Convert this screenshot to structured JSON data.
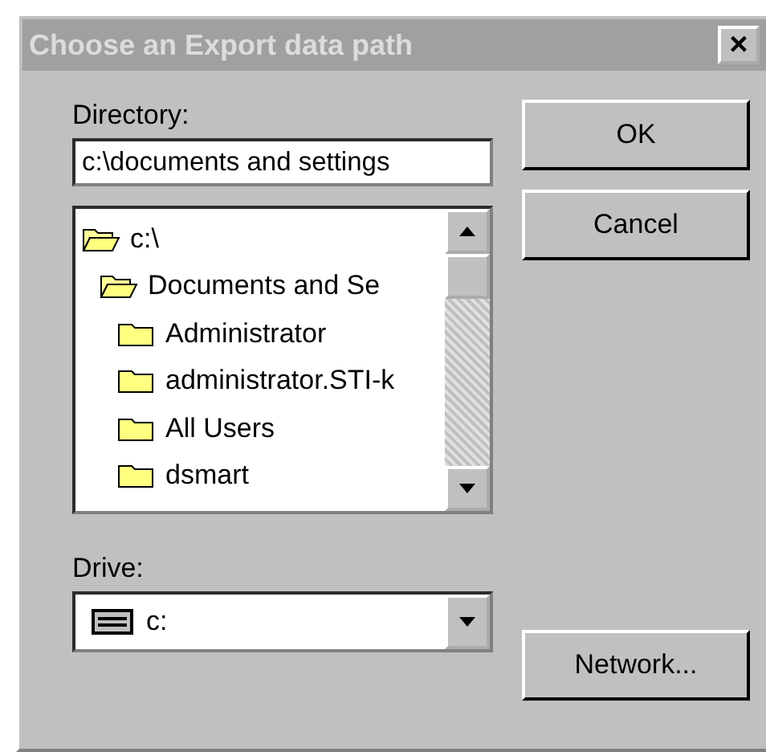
{
  "window": {
    "title": "Choose an Export data path",
    "close": "×"
  },
  "directory": {
    "label": "Directory:",
    "value": "c:\\documents and settings"
  },
  "tree": [
    {
      "name": "c:\\",
      "kind": "open",
      "children": [
        {
          "name": "Documents and Se",
          "kind": "open",
          "children": [
            {
              "name": "Administrator",
              "kind": "closed"
            },
            {
              "name": "administrator.STI-k",
              "kind": "closed"
            },
            {
              "name": "All Users",
              "kind": "closed"
            },
            {
              "name": "dsmart",
              "kind": "closed"
            }
          ]
        }
      ]
    }
  ],
  "drive": {
    "label": "Drive:",
    "value": "c:"
  },
  "buttons": {
    "ok": "OK",
    "cancel": "Cancel",
    "network": "Network..."
  }
}
